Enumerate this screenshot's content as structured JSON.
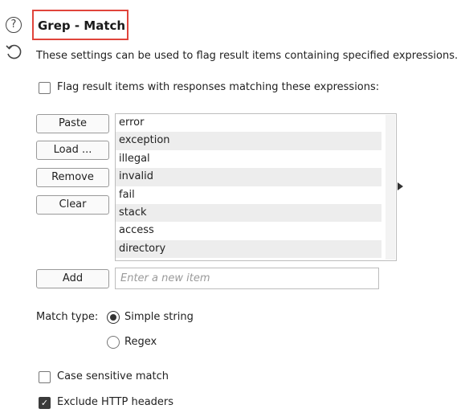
{
  "header": {
    "title": "Grep - Match",
    "help_icon_glyph": "?",
    "description": "These settings can be used to flag result items containing specified expressions."
  },
  "flag_checkbox": {
    "label": "Flag result items with responses matching these expressions:",
    "checked": false
  },
  "buttons": {
    "paste": "Paste",
    "load": "Load ...",
    "remove": "Remove",
    "clear": "Clear",
    "add": "Add"
  },
  "expressions": [
    "error",
    "exception",
    "illegal",
    "invalid",
    "fail",
    "stack",
    "access",
    "directory"
  ],
  "new_item": {
    "value": "",
    "placeholder": "Enter a new item"
  },
  "match_type": {
    "label": "Match type:",
    "options": [
      "Simple string",
      "Regex"
    ],
    "selected": "Simple string"
  },
  "case_sensitive": {
    "label": "Case sensitive match",
    "checked": false
  },
  "exclude_headers": {
    "label": "Exclude HTTP headers",
    "checked": true
  }
}
